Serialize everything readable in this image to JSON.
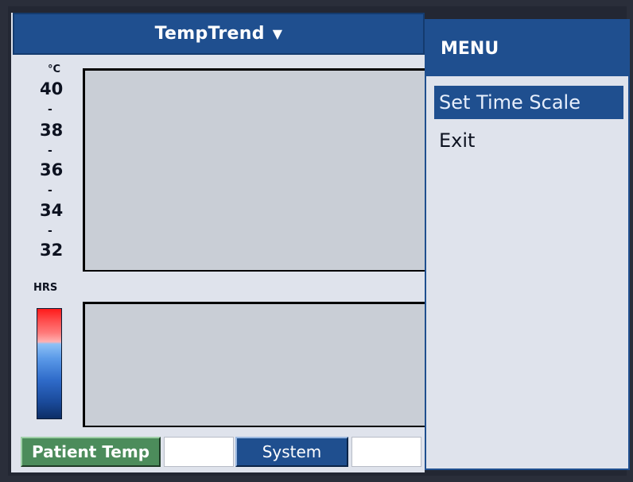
{
  "title": "TempTrend",
  "chart": {
    "unit": "°C",
    "ticks": [
      "40",
      "38",
      "36",
      "34",
      "32"
    ],
    "hrs_label": "HRS"
  },
  "menu": {
    "header": "MENU",
    "items": [
      {
        "label": "Set Time Scale",
        "selected": true
      },
      {
        "label": "Exit",
        "selected": false
      }
    ]
  },
  "bottom": {
    "patient_temp": "Patient Temp",
    "system": "System"
  },
  "colors": {
    "brand_blue": "#1f4f8f",
    "patient_green": "#4c8c5b",
    "panel_bg": "#dfe3ec",
    "chart_bg": "#c9ced6"
  }
}
